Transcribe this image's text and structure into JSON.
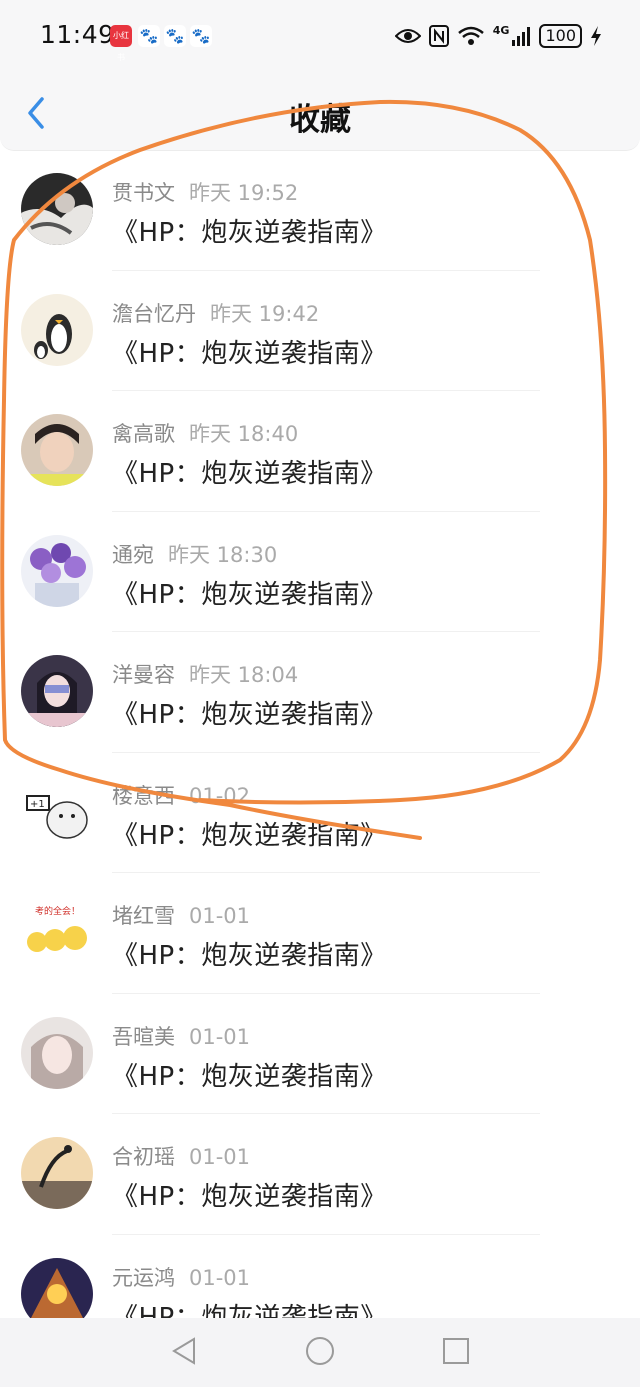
{
  "status_bar": {
    "time": "11:49",
    "app_icon_label": "小红书",
    "network": "4G",
    "battery": "100"
  },
  "header": {
    "title": "收藏"
  },
  "favorites": [
    {
      "name": "贯书文",
      "time": "昨天 19:52",
      "book": "《HP：炮灰逆袭指南》"
    },
    {
      "name": "澹台忆丹",
      "time": "昨天 19:42",
      "book": "《HP：炮灰逆袭指南》"
    },
    {
      "name": "禽高歌",
      "time": "昨天 18:40",
      "book": "《HP：炮灰逆袭指南》"
    },
    {
      "name": "通宛",
      "time": "昨天 18:30",
      "book": "《HP：炮灰逆袭指南》"
    },
    {
      "name": "洋曼容",
      "time": "昨天 18:04",
      "book": "《HP：炮灰逆袭指南》"
    },
    {
      "name": "楼意西",
      "time": "01-02",
      "book": "《HP：炮灰逆袭指南》"
    },
    {
      "name": "堵红雪",
      "time": "01-01",
      "book": "《HP：炮灰逆袭指南》"
    },
    {
      "name": "吾暄美",
      "time": "01-01",
      "book": "《HP：炮灰逆袭指南》"
    },
    {
      "name": "合初瑶",
      "time": "01-01",
      "book": "《HP：炮灰逆袭指南》"
    },
    {
      "name": "元运鸿",
      "time": "01-01",
      "book": "《HP：炮灰逆袭指南》"
    }
  ],
  "avatar_sticker_texts": {
    "row6": "+1",
    "row7": "考的全会！"
  },
  "colors": {
    "accent_blue": "#3a8ee6",
    "annotation_orange": "#f0883e"
  },
  "nav": {
    "back": "triangle-back-icon",
    "home": "circle-home-icon",
    "recent": "square-recent-icon"
  }
}
